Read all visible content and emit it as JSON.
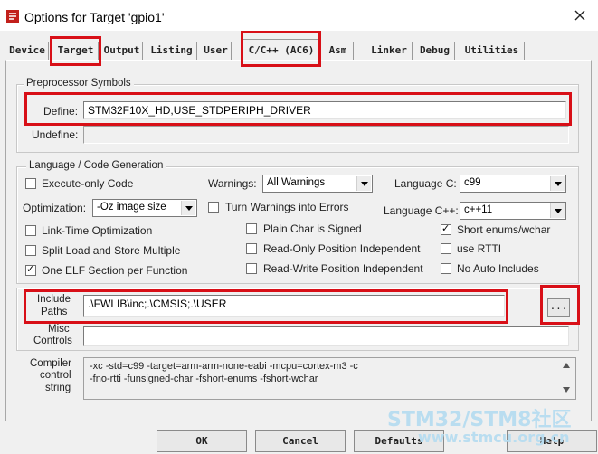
{
  "window": {
    "title": "Options for Target 'gpio1'"
  },
  "tabs": [
    {
      "label": "Device"
    },
    {
      "label": "Target"
    },
    {
      "label": "Output"
    },
    {
      "label": "Listing"
    },
    {
      "label": "User"
    },
    {
      "label": "C/C++ (AC6)"
    },
    {
      "label": "Asm"
    },
    {
      "label": "Linker"
    },
    {
      "label": "Debug"
    },
    {
      "label": "Utilities"
    }
  ],
  "active_tab": "C/C++ (AC6)",
  "preprocessor": {
    "group_title": "Preprocessor Symbols",
    "define_label": "Define:",
    "define_value": "STM32F10X_HD,USE_STDPERIPH_DRIVER",
    "undefine_label": "Undefine:",
    "undefine_value": ""
  },
  "codegen": {
    "group_title": "Language / Code Generation",
    "execute_only": {
      "label": "Execute-only Code",
      "checked": false
    },
    "warnings": {
      "label": "Warnings:",
      "value": "All Warnings"
    },
    "language_c": {
      "label": "Language C:",
      "value": "c99"
    },
    "optimization": {
      "label": "Optimization:",
      "value": "-Oz image size"
    },
    "turn_warnings_errors": {
      "label": "Turn Warnings into Errors",
      "checked": false
    },
    "language_cpp": {
      "label": "Language C++:",
      "value": "c++11"
    },
    "link_time_opt": {
      "label": "Link-Time Optimization",
      "checked": false
    },
    "plain_char_signed": {
      "label": "Plain Char is Signed",
      "checked": false
    },
    "short_enums": {
      "label": "Short enums/wchar",
      "checked": true
    },
    "split_load_store": {
      "label": "Split Load and Store Multiple",
      "checked": false
    },
    "readonly_pos_indep": {
      "label": "Read-Only Position Independent",
      "checked": false
    },
    "use_rtti": {
      "label": "use RTTI",
      "checked": false
    },
    "one_elf_section": {
      "label": "One ELF Section per Function",
      "checked": true
    },
    "readwrite_pos_indep": {
      "label": "Read-Write Position Independent",
      "checked": false
    },
    "no_auto_includes": {
      "label": "No Auto Includes",
      "checked": false
    }
  },
  "paths": {
    "include_label_1": "Include",
    "include_label_2": "Paths",
    "include_value": ".\\FWLIB\\inc;.\\CMSIS;.\\USER",
    "browse_label": "...",
    "misc_label_1": "Misc",
    "misc_label_2": "Controls",
    "misc_value": ""
  },
  "compiler": {
    "label_1": "Compiler",
    "label_2": "control",
    "label_3": "string",
    "line_1": "-xc -std=c99 -target=arm-arm-none-eabi -mcpu=cortex-m3 -c",
    "line_2": "-fno-rtti -funsigned-char -fshort-enums -fshort-wchar"
  },
  "buttons": {
    "ok": "OK",
    "cancel": "Cancel",
    "defaults": "Defaults",
    "help": "Help"
  },
  "watermark": {
    "line_1": "STM32/STM8社区",
    "line_2": "www.stmcu.org.cn"
  },
  "colors": {
    "highlight": "#d80f17",
    "dialog_bg": "#f0f0f0",
    "watermark": "#b9ddf0"
  },
  "icons": {
    "app": "keil-options-icon",
    "close": "close-icon",
    "dropdown": "chevron-down-icon",
    "browse": "ellipsis-icon"
  }
}
